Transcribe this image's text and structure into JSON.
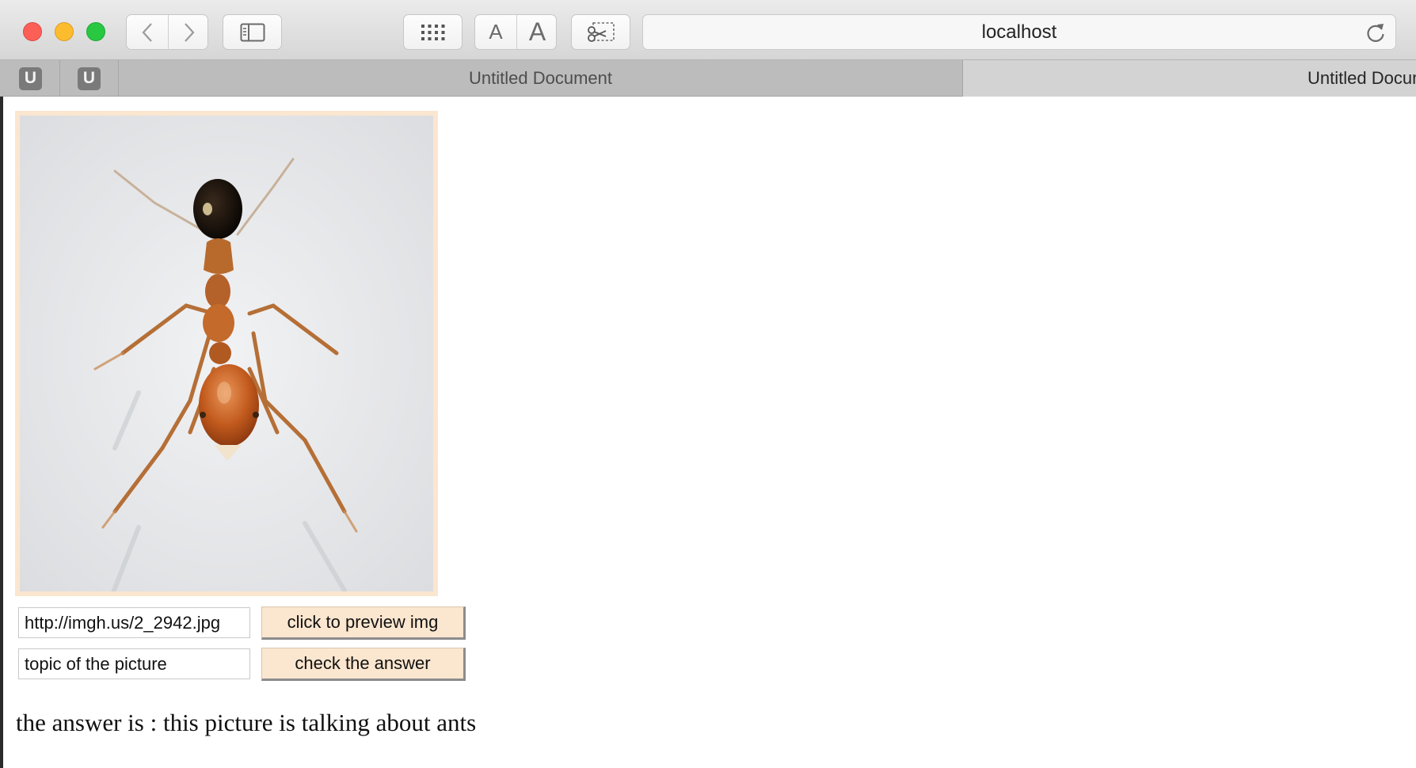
{
  "browser": {
    "address": "localhost",
    "icons": {
      "back": "chevron-left-icon",
      "forward": "chevron-right-icon",
      "sidebar": "sidebar-icon",
      "grid": "grid-icon",
      "text_smaller": "A",
      "text_larger": "A",
      "clip": "scissors-icon",
      "reload": "reload-icon"
    },
    "pinned_tabs": [
      "U",
      "U"
    ],
    "tabs": [
      {
        "label": "Untitled Document",
        "active": true
      },
      {
        "label": "Untitled Document",
        "active": false
      }
    ]
  },
  "page": {
    "image_alt": "ant photo",
    "url_input_value": "http://imgh.us/2_2942.jpg",
    "preview_button_label": "click to preview img",
    "topic_input_value": "topic of the picture",
    "check_button_label": "check the answer",
    "answer_text": "the answer is : this picture is talking about ants"
  },
  "colors": {
    "accent": "#fbe6cf",
    "traffic_red": "#fc5f57",
    "traffic_yellow": "#fdbc2e",
    "traffic_green": "#28c840"
  }
}
